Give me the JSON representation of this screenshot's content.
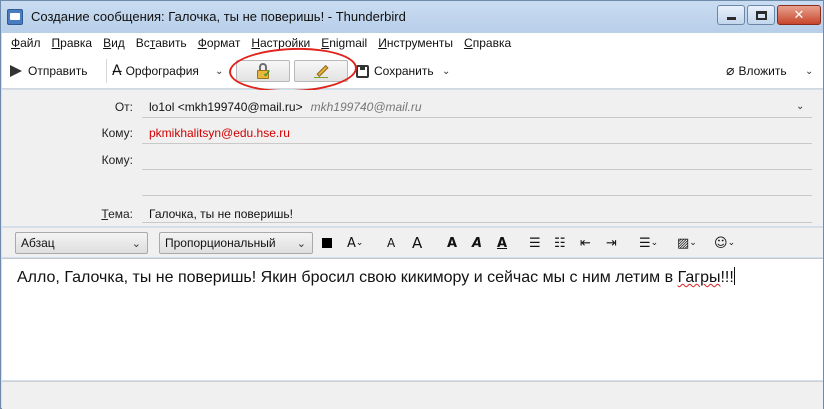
{
  "window": {
    "title": "Создание сообщения: Галочка, ты не поверишь! - Thunderbird",
    "controls": {
      "minimize": "minimize-icon",
      "maximize": "maximize-icon",
      "close": "✕"
    }
  },
  "menubar": {
    "items": [
      {
        "pre": "",
        "ul": "Ф",
        "post": "айл"
      },
      {
        "pre": "",
        "ul": "П",
        "post": "равка"
      },
      {
        "pre": "",
        "ul": "В",
        "post": "ид"
      },
      {
        "pre": "Вс",
        "ul": "т",
        "post": "авить"
      },
      {
        "pre": "",
        "ul": "Ф",
        "post": "ормат"
      },
      {
        "pre": "",
        "ul": "Н",
        "post": "астройки"
      },
      {
        "pre": "",
        "ul": "E",
        "post": "nigmail"
      },
      {
        "pre": "",
        "ul": "И",
        "post": "нструменты"
      },
      {
        "pre": "",
        "ul": "С",
        "post": "правка"
      }
    ]
  },
  "toolbar": {
    "send_label": "Отправить",
    "spell_label": "Орфография",
    "save_label": "Сохранить",
    "attach_label": "Вложить",
    "chevron": "❯",
    "drop_chevron": "⌄"
  },
  "header": {
    "from_label": "От:",
    "from_value": "lo1ol <mkh199740@mail.ru>",
    "from_hint": "mkh199740@mail.ru",
    "to_label": "Кому:",
    "to_value": "pkmikhalitsyn@edu.hse.ru",
    "cc_label": "Кому:",
    "cc_value": "",
    "subject_label_ul": "Т",
    "subject_label_rest": "ема:",
    "subject_value": "Галочка, ты не поверишь!"
  },
  "format": {
    "paragraph_value": "Абзац",
    "font_value": "Пропорциональный",
    "text_color": "#000000",
    "buttons": {
      "size_down": "A",
      "size_up": "A",
      "bold": "A",
      "italic": "A",
      "underline": "A",
      "bullets": "☰",
      "numbers": "☷",
      "outdent": "⇤",
      "indent": "⇥",
      "align": "☰",
      "image": "▨",
      "emoji": "☺",
      "drop": "⌄"
    }
  },
  "body": {
    "text_before": "Алло, Галочка, ты не поверишь! Якин бросил свою кикимору и сейчас мы с ним летим в ",
    "text_misspelled": "Гагры",
    "text_after": "!!!"
  },
  "colors": {
    "annotation_oval": "#e0241d",
    "recipient_text": "#d30000",
    "titlebar": "#c9dcf1"
  }
}
